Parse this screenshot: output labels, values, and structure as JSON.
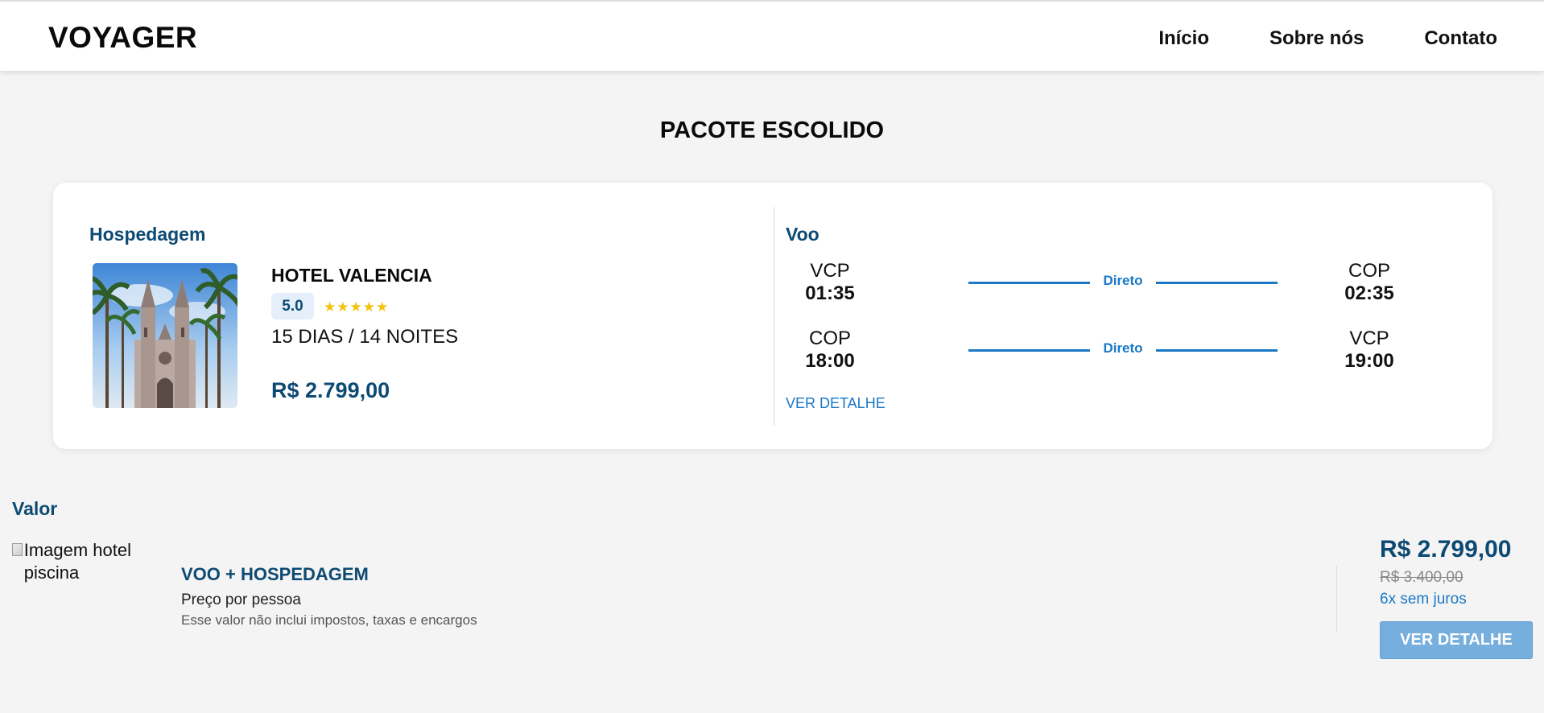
{
  "header": {
    "brand": "VOYAGER",
    "nav": [
      "Início",
      "Sobre nós",
      "Contato"
    ]
  },
  "page_title": "PACOTE ESCOLIDO",
  "hospedagem": {
    "section_title": "Hospedagem",
    "hotel_name": "HOTEL VALENCIA",
    "rating": "5.0",
    "stars": "★★★★★",
    "stars_value": 5,
    "duration": "15 DIAS / 14 NOITES",
    "price": "R$ 2.799,00"
  },
  "voo": {
    "section_title": "Voo",
    "flights": [
      {
        "from_code": "VCP",
        "from_time": "01:35",
        "type": "Direto",
        "to_code": "COP",
        "to_time": "02:35"
      },
      {
        "from_code": "COP",
        "from_time": "18:00",
        "type": "Direto",
        "to_code": "VCP",
        "to_time": "19:00"
      }
    ],
    "detail_link": "VER DETALHE"
  },
  "valor": {
    "section_title": "Valor",
    "image_alt": "Imagem hotel piscina",
    "package_name": "VOO + HOSPEDAGEM",
    "price_per": "Preço por pessoa",
    "note": "Esse valor não inclui impostos, taxas e encargos",
    "price": "R$ 2.799,00",
    "old_price": "R$ 3.400,00",
    "installments": "6x sem juros",
    "button": "VER DETALHE"
  },
  "colors": {
    "primary_dark": "#0d4a73",
    "accent_blue": "#1a78c6",
    "button_bg": "#76aedd",
    "star": "#f4c10b"
  }
}
